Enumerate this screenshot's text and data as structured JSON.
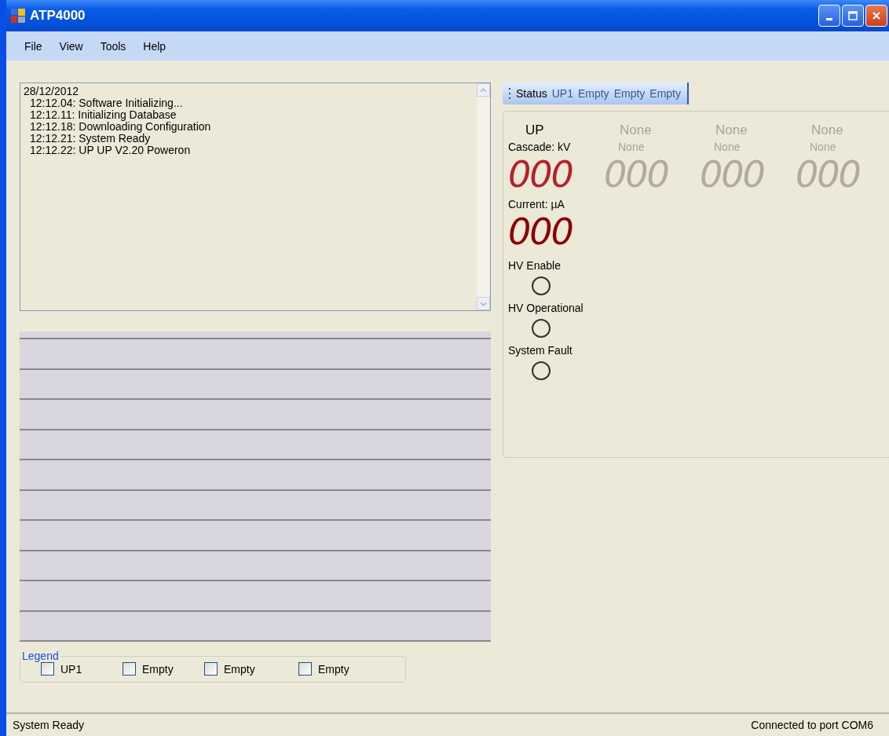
{
  "window": {
    "title": "ATP4000"
  },
  "menu": [
    "File",
    "View",
    "Tools",
    "Help"
  ],
  "log": {
    "date": "28/12/2012",
    "lines": [
      "12:12.04:  Software Initializing...",
      "12:12.11:  Initializing Database",
      "12:12.18:  Downloading Configuration",
      "12:12.21:  System Ready",
      "12:12.22: UP  UP V2.20 Poweron"
    ]
  },
  "legend": {
    "title": "Legend",
    "items": [
      {
        "label": "UP1",
        "checked": false
      },
      {
        "label": "Empty",
        "checked": false
      },
      {
        "label": "Empty",
        "checked": false
      },
      {
        "label": "Empty",
        "checked": false
      }
    ]
  },
  "tabs": [
    {
      "label": "Status",
      "selected": true
    },
    {
      "label": "UP1",
      "selected": false
    },
    {
      "label": "Empty",
      "selected": false
    },
    {
      "label": "Empty",
      "selected": false
    },
    {
      "label": "Empty",
      "selected": false
    }
  ],
  "modules": [
    {
      "name": "UP",
      "active": true,
      "voltage_label": "Cascade: kV",
      "voltage": "000",
      "current_label": "Current:  µA",
      "current": "000",
      "indicators": [
        {
          "label": "HV Enable",
          "on": false
        },
        {
          "label": "HV Operational",
          "on": false
        },
        {
          "label": "System Fault",
          "on": false
        }
      ]
    },
    {
      "name": "None",
      "active": false,
      "voltage_label": "None",
      "voltage": "000"
    },
    {
      "name": "None",
      "active": false,
      "voltage_label": "None",
      "voltage": "000"
    },
    {
      "name": "None",
      "active": false,
      "voltage_label": "None",
      "voltage": "000"
    }
  ],
  "status_bar": {
    "left": "System Ready",
    "right": "Connected to port COM6"
  }
}
